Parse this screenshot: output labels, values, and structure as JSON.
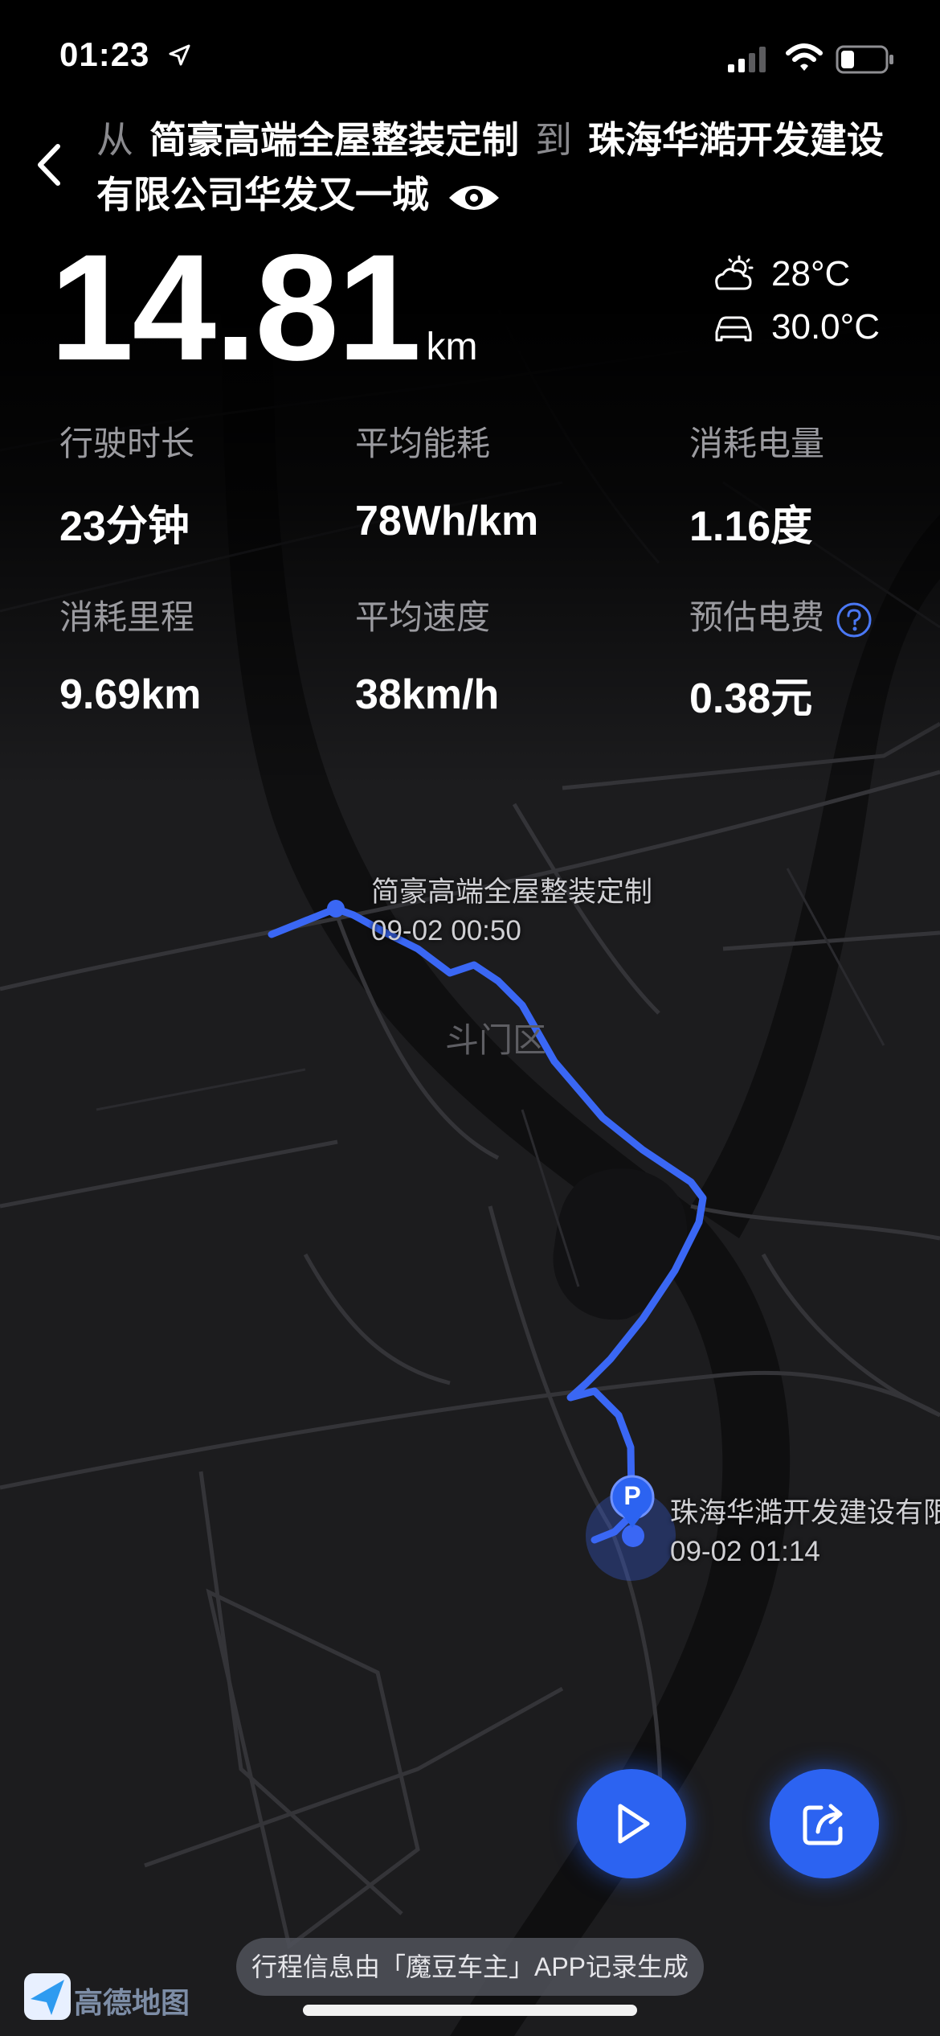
{
  "status_bar": {
    "time": "01:23"
  },
  "header": {
    "from_word": "从",
    "from_place": "简豪高端全屋整装定制",
    "to_word": "到",
    "to_place": "珠海华澔开发建设有限公司华发又一城"
  },
  "summary": {
    "distance_value": "14.81",
    "distance_unit": "km",
    "weather_temp": "28°C",
    "car_temp": "30.0°C"
  },
  "stats": [
    {
      "label": "行驶时长",
      "value": "23分钟"
    },
    {
      "label": "平均能耗",
      "value": "78Wh/km"
    },
    {
      "label": "消耗电量",
      "value": "1.16度"
    },
    {
      "label": "消耗里程",
      "value": "9.69km"
    },
    {
      "label": "平均速度",
      "value": "38km/h"
    },
    {
      "label": "预估电费",
      "value": "0.38元"
    }
  ],
  "map": {
    "district_label": "斗门区",
    "start": {
      "name": "简豪高端全屋整装定制",
      "time": "09-02 00:50"
    },
    "end": {
      "name": "珠海华澔开发建设有限",
      "time": "09-02 01:14"
    },
    "parking_label": "P",
    "route_color": "#3a67f4",
    "map_logo": "高德地图"
  },
  "footer": {
    "note": "行程信息由「魔豆车主」APP记录生成"
  },
  "icons": {
    "back": "chevron-left-icon",
    "visibility": "eye-icon",
    "weather": "partly-sunny-icon",
    "car": "car-icon",
    "help": "question-circle-icon",
    "play": "play-icon",
    "share": "share-icon"
  },
  "colors": {
    "accent": "#2c63f1",
    "background": "#000000",
    "muted_text": "#9b9ba0"
  }
}
